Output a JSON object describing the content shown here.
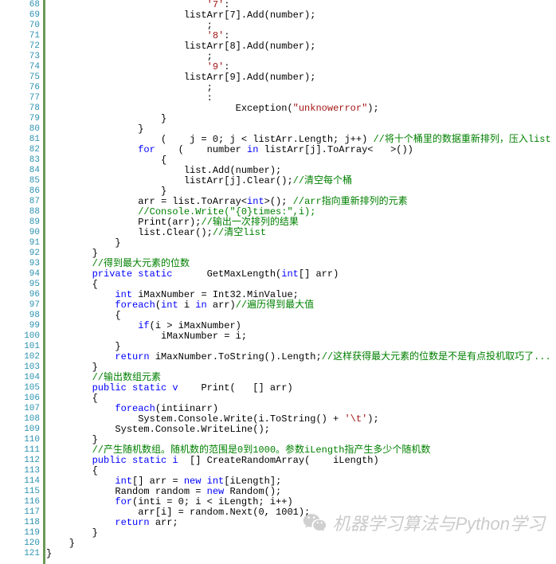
{
  "startLine": 68,
  "endLine": 121,
  "watermark": "机器学习算法与Python学习",
  "lines": [
    [
      {
        "c": "n",
        "t": "                            "
      },
      {
        "c": "s",
        "t": "'7'"
      },
      {
        "c": "n",
        "t": ":"
      }
    ],
    [
      {
        "c": "n",
        "t": "                        listArr[7].Add(number);"
      }
    ],
    [
      {
        "c": "n",
        "t": "                            ;"
      }
    ],
    [
      {
        "c": "n",
        "t": "                            "
      },
      {
        "c": "s",
        "t": "'8'"
      },
      {
        "c": "n",
        "t": ":"
      }
    ],
    [
      {
        "c": "n",
        "t": "                        listArr[8].Add(number);"
      }
    ],
    [
      {
        "c": "n",
        "t": "                            ;"
      }
    ],
    [
      {
        "c": "n",
        "t": "                            "
      },
      {
        "c": "s",
        "t": "'9'"
      },
      {
        "c": "n",
        "t": ":"
      }
    ],
    [
      {
        "c": "n",
        "t": "                        listArr[9].Add(number);"
      }
    ],
    [
      {
        "c": "n",
        "t": "                            ;"
      }
    ],
    [
      {
        "c": "n",
        "t": "                            :"
      }
    ],
    [
      {
        "c": "n",
        "t": "                                 Exception("
      },
      {
        "c": "s",
        "t": "\"unknowerror\""
      },
      {
        "c": "n",
        "t": ");"
      }
    ],
    [
      {
        "c": "n",
        "t": "                    }"
      }
    ],
    [
      {
        "c": "n",
        "t": "                }"
      }
    ],
    [
      {
        "c": "n",
        "t": "                    (    j = 0; j < listArr.Length; j++) "
      },
      {
        "c": "c",
        "t": "//将十个桶里的数据重新排列，压入list"
      }
    ],
    [
      {
        "c": "n",
        "t": "                "
      },
      {
        "c": "k",
        "t": "for"
      },
      {
        "c": "n",
        "t": "    (    number "
      },
      {
        "c": "k",
        "t": "in"
      },
      {
        "c": "n",
        "t": " listArr[j].ToArray<   >())"
      }
    ],
    [
      {
        "c": "n",
        "t": "                    {"
      }
    ],
    [
      {
        "c": "n",
        "t": "                        list.Add(number);"
      }
    ],
    [
      {
        "c": "n",
        "t": "                        listArr[j].Clear();"
      },
      {
        "c": "c",
        "t": "//清空每个桶"
      }
    ],
    [
      {
        "c": "n",
        "t": "                    }"
      }
    ],
    [
      {
        "c": "n",
        "t": "                arr = list.ToArray<"
      },
      {
        "c": "k",
        "t": "int"
      },
      {
        "c": "n",
        "t": ">(); "
      },
      {
        "c": "c",
        "t": "//arr指向重新排列的元素"
      }
    ],
    [
      {
        "c": "n",
        "t": "                "
      },
      {
        "c": "c",
        "t": "//Console.Write(\"{0}times:\",i);"
      }
    ],
    [
      {
        "c": "n",
        "t": "                Print(arr);"
      },
      {
        "c": "c",
        "t": "//输出一次排列的结果"
      }
    ],
    [
      {
        "c": "n",
        "t": "                list.Clear();"
      },
      {
        "c": "c",
        "t": "//清空list"
      }
    ],
    [
      {
        "c": "n",
        "t": "            }"
      }
    ],
    [
      {
        "c": "n",
        "t": "        }"
      }
    ],
    [
      {
        "c": "n",
        "t": "        "
      },
      {
        "c": "c",
        "t": "//得到最大元素的位数"
      }
    ],
    [
      {
        "c": "n",
        "t": "        "
      },
      {
        "c": "k",
        "t": "private static"
      },
      {
        "c": "n",
        "t": "      GetMaxLength("
      },
      {
        "c": "k",
        "t": "int"
      },
      {
        "c": "n",
        "t": "[] arr)"
      }
    ],
    [
      {
        "c": "n",
        "t": "        {"
      }
    ],
    [
      {
        "c": "n",
        "t": "            "
      },
      {
        "c": "k",
        "t": "int"
      },
      {
        "c": "n",
        "t": " iMaxNumber = Int32.MinValue;"
      }
    ],
    [
      {
        "c": "n",
        "t": "            "
      },
      {
        "c": "k",
        "t": "foreach"
      },
      {
        "c": "n",
        "t": "("
      },
      {
        "c": "k",
        "t": "int"
      },
      {
        "c": "n",
        "t": " i "
      },
      {
        "c": "k",
        "t": "in"
      },
      {
        "c": "n",
        "t": " arr)"
      },
      {
        "c": "c",
        "t": "//遍历得到最大值"
      }
    ],
    [
      {
        "c": "n",
        "t": "            {"
      }
    ],
    [
      {
        "c": "n",
        "t": "                "
      },
      {
        "c": "k",
        "t": "if"
      },
      {
        "c": "n",
        "t": "(i > iMaxNumber)"
      }
    ],
    [
      {
        "c": "n",
        "t": "                    iMaxNumber = i;"
      }
    ],
    [
      {
        "c": "n",
        "t": "            }"
      }
    ],
    [
      {
        "c": "n",
        "t": "            "
      },
      {
        "c": "k",
        "t": "return"
      },
      {
        "c": "n",
        "t": " iMaxNumber.ToString().Length;"
      },
      {
        "c": "c",
        "t": "//这样获得最大元素的位数是不是有点投机取巧了..."
      }
    ],
    [
      {
        "c": "n",
        "t": "        }"
      }
    ],
    [
      {
        "c": "n",
        "t": "        "
      },
      {
        "c": "c",
        "t": "//输出数组元素"
      }
    ],
    [
      {
        "c": "n",
        "t": "        "
      },
      {
        "c": "k",
        "t": "public static v"
      },
      {
        "c": "n",
        "t": "    Print(   [] arr)"
      }
    ],
    [
      {
        "c": "n",
        "t": "        {"
      }
    ],
    [
      {
        "c": "n",
        "t": "            "
      },
      {
        "c": "k",
        "t": "foreach"
      },
      {
        "c": "n",
        "t": "(intiinarr)"
      }
    ],
    [
      {
        "c": "n",
        "t": "                System.Console.Write(i.ToString() + "
      },
      {
        "c": "s",
        "t": "'\\t'"
      },
      {
        "c": "n",
        "t": ");"
      }
    ],
    [
      {
        "c": "n",
        "t": "            System.Console.WriteLine();"
      }
    ],
    [
      {
        "c": "n",
        "t": "        }"
      }
    ],
    [
      {
        "c": "n",
        "t": "        "
      },
      {
        "c": "c",
        "t": "//产生随机数组。随机数的范围是0到1000。参数iLength指产生多少个随机数"
      }
    ],
    [
      {
        "c": "n",
        "t": "        "
      },
      {
        "c": "k",
        "t": "public static i"
      },
      {
        "c": "n",
        "t": "  [] CreateRandomArray(    iLength)"
      }
    ],
    [
      {
        "c": "n",
        "t": "        {"
      }
    ],
    [
      {
        "c": "n",
        "t": "            "
      },
      {
        "c": "k",
        "t": "int"
      },
      {
        "c": "n",
        "t": "[] arr = "
      },
      {
        "c": "k",
        "t": "new int"
      },
      {
        "c": "n",
        "t": "[iLength];"
      }
    ],
    [
      {
        "c": "n",
        "t": "            Random random = "
      },
      {
        "c": "k",
        "t": "new"
      },
      {
        "c": "n",
        "t": " Random();"
      }
    ],
    [
      {
        "c": "n",
        "t": "            "
      },
      {
        "c": "k",
        "t": "for"
      },
      {
        "c": "n",
        "t": "(inti = 0; i < iLength; i++)"
      }
    ],
    [
      {
        "c": "n",
        "t": "                arr[i] = random.Next(0, 1001);"
      }
    ],
    [
      {
        "c": "n",
        "t": "            "
      },
      {
        "c": "k",
        "t": "return"
      },
      {
        "c": "n",
        "t": " arr;"
      }
    ],
    [
      {
        "c": "n",
        "t": "        }"
      }
    ],
    [
      {
        "c": "n",
        "t": "    }"
      }
    ],
    [
      {
        "c": "n",
        "t": "}"
      }
    ]
  ]
}
